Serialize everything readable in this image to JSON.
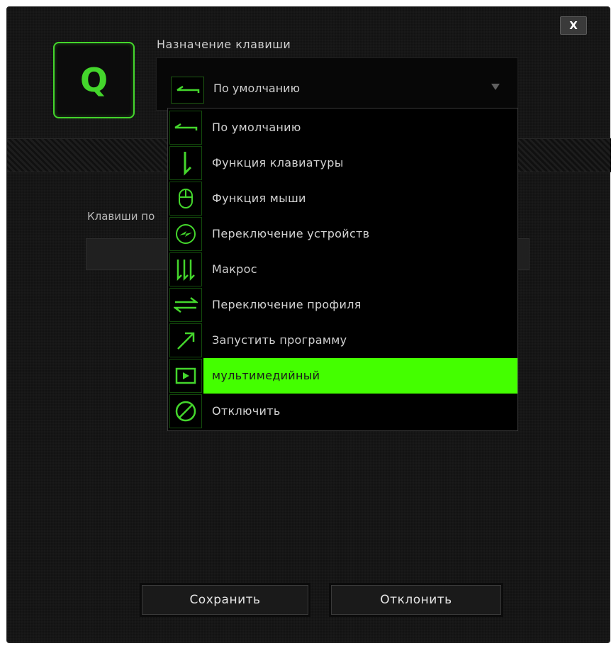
{
  "dialog": {
    "close_label": "X",
    "key_label": "Q",
    "assign_title": "Назначение клавиши",
    "selected_value": "По умолчанию",
    "selected_icon": "arrow-left-icon",
    "background_label": "Клавиши по"
  },
  "menu": {
    "items": [
      {
        "label": "По умолчанию",
        "icon": "arrow-left-icon"
      },
      {
        "label": "Функция клавиатуры",
        "icon": "keyboard-arrow-down-icon"
      },
      {
        "label": "Функция мыши",
        "icon": "mouse-icon"
      },
      {
        "label": "Переключение устройств",
        "icon": "device-switch-icon"
      },
      {
        "label": "Макрос",
        "icon": "macro-icon"
      },
      {
        "label": "Переключение профиля",
        "icon": "profile-switch-icon"
      },
      {
        "label": "Запустить программу",
        "icon": "launch-program-icon"
      },
      {
        "label": "мультимедийный",
        "icon": "multimedia-play-icon",
        "selected": true
      },
      {
        "label": "Отключить",
        "icon": "disable-icon"
      }
    ]
  },
  "buttons": {
    "save": "Сохранить",
    "cancel": "Отклонить"
  },
  "colors": {
    "accent": "#44d62c",
    "highlight": "#44ff00",
    "background": "#121212"
  }
}
